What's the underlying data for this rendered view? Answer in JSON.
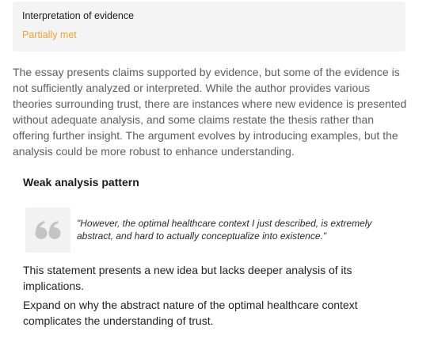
{
  "criterion": {
    "title": "Interpretation of evidence",
    "status": "Partially met",
    "status_color": "#e8a43a"
  },
  "feedback": {
    "summary": "The essay presents claims supported by evidence, but some of the evidence is not sufficiently analyzed or interpreted. While the author provides various theories surrounding trust, there are instances where new evidence is presented without adequate analysis, and some claims restate the thesis rather than offering further insight. The argument evolves by introducing examples, but the analysis could be more robust to enhance understanding."
  },
  "pattern": {
    "heading": "Weak analysis pattern",
    "icon": "quote-icon",
    "quote": "\"However, the optimal healthcare context I just described, is extremely abstract, and hard to actually conceptualize into existence.\"",
    "explanation": "This statement presents a new idea but lacks deeper analysis of its implications.",
    "suggestion": "Expand on why the abstract nature of the optimal healthcare context complicates the understanding of trust."
  }
}
